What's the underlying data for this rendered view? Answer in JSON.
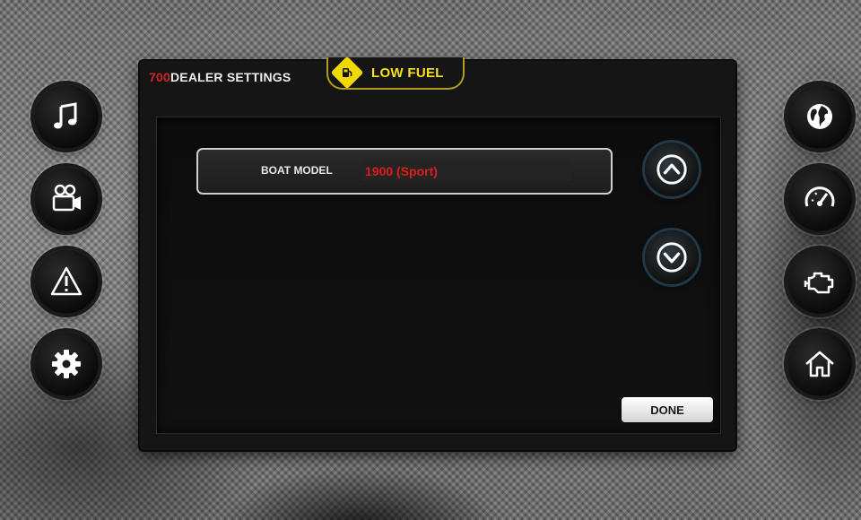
{
  "header": {
    "title_number": "700",
    "title_text": "DEALER SETTINGS",
    "alert_text": "LOW FUEL"
  },
  "settings": {
    "boat_model_label": "BOAT MODEL",
    "boat_model_value": "1900 (Sport)"
  },
  "buttons": {
    "done_label": "DONE"
  },
  "icons": {
    "left": [
      "music-icon",
      "video-camera-icon",
      "warning-icon",
      "settings-gear-icon"
    ],
    "right": [
      "globe-icon",
      "speedometer-icon",
      "engine-icon",
      "home-icon"
    ],
    "arrows": [
      "chevron-up-icon",
      "chevron-down-icon"
    ],
    "alert": "fuel-pump-icon"
  },
  "colors": {
    "accent_red": "#d42222",
    "alert_yellow": "#f5e21a",
    "panel": "#151515"
  }
}
